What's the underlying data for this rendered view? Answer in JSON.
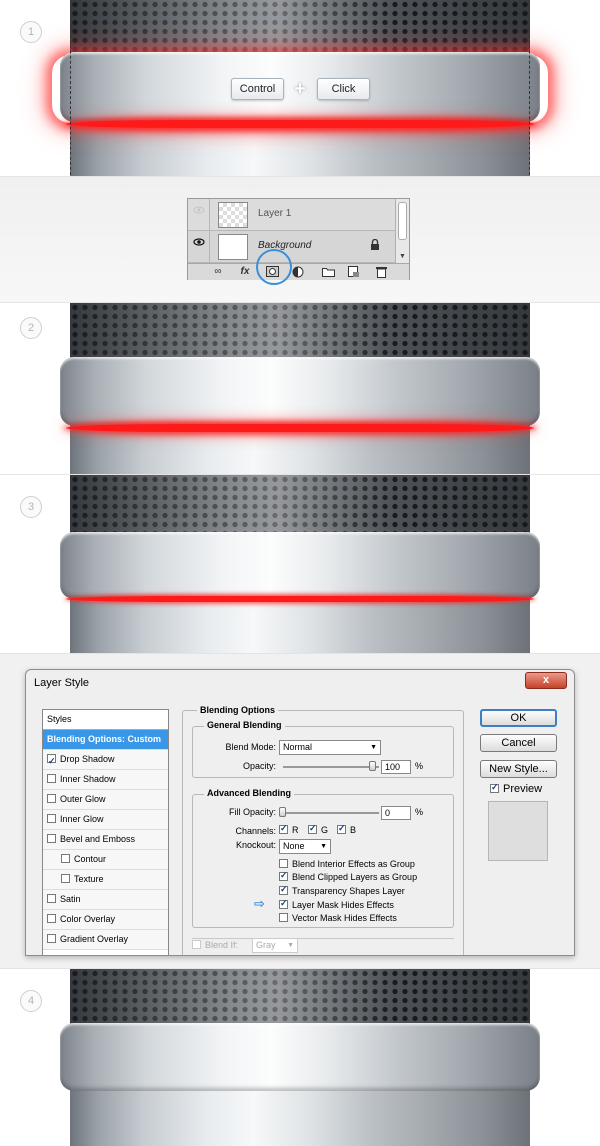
{
  "steps": [
    "1",
    "2",
    "3",
    "4"
  ],
  "shortcut": {
    "key1": "Control",
    "plus": "+",
    "key2": "Click"
  },
  "layers_panel": {
    "layers": [
      {
        "name": "Layer 1",
        "visible": false,
        "thumbnail": "transparent"
      },
      {
        "name": "Background",
        "visible": true,
        "thumbnail": "white"
      }
    ],
    "footer_icons": [
      "link-icon",
      "fx-icon",
      "add-layer-mask-icon",
      "adjustment-layer-icon",
      "group-folder-icon",
      "new-layer-icon",
      "trash-icon"
    ],
    "fx_label": "fx",
    "highlight_color": "#3a8fd8"
  },
  "dialog": {
    "title": "Layer Style",
    "close_label": "x",
    "styles_header": "Styles",
    "styles": [
      {
        "label": "Blending Options: Custom",
        "active": true,
        "checkbox": false
      },
      {
        "label": "Drop Shadow",
        "checked": true,
        "checkbox": true
      },
      {
        "label": "Inner Shadow",
        "checked": false,
        "checkbox": true
      },
      {
        "label": "Outer Glow",
        "checked": false,
        "checkbox": true
      },
      {
        "label": "Inner Glow",
        "checked": false,
        "checkbox": true
      },
      {
        "label": "Bevel and Emboss",
        "checked": false,
        "checkbox": true
      },
      {
        "label": "Contour",
        "checked": false,
        "checkbox": true,
        "sub": true
      },
      {
        "label": "Texture",
        "checked": false,
        "checkbox": true,
        "sub": true
      },
      {
        "label": "Satin",
        "checked": false,
        "checkbox": true
      },
      {
        "label": "Color Overlay",
        "checked": false,
        "checkbox": true
      },
      {
        "label": "Gradient Overlay",
        "checked": false,
        "checkbox": true
      }
    ],
    "blending_options": {
      "title": "Blending Options",
      "general_title": "General Blending",
      "blend_mode_label": "Blend Mode:",
      "blend_mode_value": "Normal",
      "opacity_label": "Opacity:",
      "opacity_value": "100",
      "percent": "%",
      "advanced_title": "Advanced Blending",
      "fill_opacity_label": "Fill Opacity:",
      "fill_opacity_value": "0",
      "channels_label": "Channels:",
      "channels": [
        {
          "label": "R",
          "checked": true
        },
        {
          "label": "G",
          "checked": true
        },
        {
          "label": "B",
          "checked": true
        }
      ],
      "knockout_label": "Knockout:",
      "knockout_value": "None",
      "options": [
        {
          "label": "Blend Interior Effects as Group",
          "checked": false
        },
        {
          "label": "Blend Clipped Layers as Group",
          "checked": true
        },
        {
          "label": "Transparency Shapes Layer",
          "checked": true
        },
        {
          "label": "Layer Mask Hides Effects",
          "checked": true
        },
        {
          "label": "Vector Mask Hides Effects",
          "checked": false
        }
      ],
      "blend_if_label": "Blend If:",
      "blend_if_value": "Gray"
    },
    "buttons": {
      "ok": "OK",
      "cancel": "Cancel",
      "new_style": "New Style..."
    },
    "preview_label": "Preview",
    "preview_checked": true
  },
  "colors": {
    "glow_red": "#ff1a1a",
    "selection_blue": "#3a97e8",
    "arrow_blue": "#3b8ad8"
  }
}
